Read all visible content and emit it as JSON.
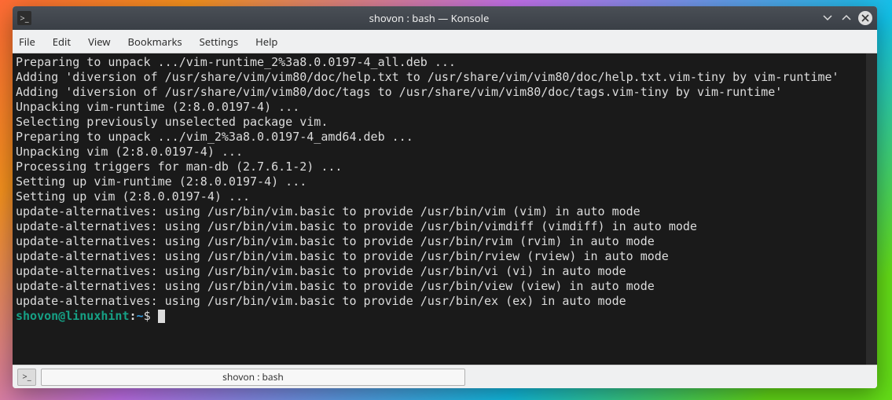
{
  "titlebar": {
    "icon_glyph": ">_",
    "title": "shovon : bash — Konsole"
  },
  "menubar": {
    "items": [
      "File",
      "Edit",
      "View",
      "Bookmarks",
      "Settings",
      "Help"
    ]
  },
  "terminal": {
    "lines": [
      "Preparing to unpack .../vim-runtime_2%3a8.0.0197-4_all.deb ...",
      "Adding 'diversion of /usr/share/vim/vim80/doc/help.txt to /usr/share/vim/vim80/doc/help.txt.vim-tiny by vim-runtime'",
      "Adding 'diversion of /usr/share/vim/vim80/doc/tags to /usr/share/vim/vim80/doc/tags.vim-tiny by vim-runtime'",
      "Unpacking vim-runtime (2:8.0.0197-4) ...",
      "Selecting previously unselected package vim.",
      "Preparing to unpack .../vim_2%3a8.0.0197-4_amd64.deb ...",
      "Unpacking vim (2:8.0.0197-4) ...",
      "Processing triggers for man-db (2.7.6.1-2) ...",
      "Setting up vim-runtime (2:8.0.0197-4) ...",
      "Setting up vim (2:8.0.0197-4) ...",
      "update-alternatives: using /usr/bin/vim.basic to provide /usr/bin/vim (vim) in auto mode",
      "update-alternatives: using /usr/bin/vim.basic to provide /usr/bin/vimdiff (vimdiff) in auto mode",
      "update-alternatives: using /usr/bin/vim.basic to provide /usr/bin/rvim (rvim) in auto mode",
      "update-alternatives: using /usr/bin/vim.basic to provide /usr/bin/rview (rview) in auto mode",
      "update-alternatives: using /usr/bin/vim.basic to provide /usr/bin/vi (vi) in auto mode",
      "update-alternatives: using /usr/bin/vim.basic to provide /usr/bin/view (view) in auto mode",
      "update-alternatives: using /usr/bin/vim.basic to provide /usr/bin/ex (ex) in auto mode"
    ],
    "prompt": {
      "user_host": "shovon@linuxhint",
      "sep": ":",
      "path": "~",
      "suffix": "$ "
    }
  },
  "tabbar": {
    "icon_glyph": ">_",
    "tab_label": "shovon : bash"
  }
}
